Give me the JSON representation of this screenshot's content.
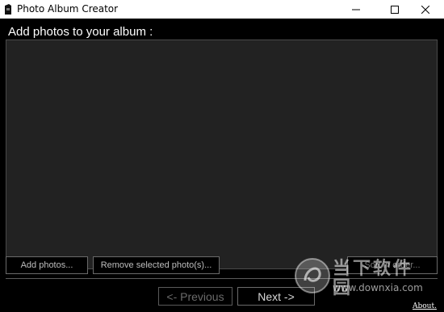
{
  "window": {
    "title": "Photo Album Creator"
  },
  "main": {
    "heading": "Add photos to your album :",
    "photos": []
  },
  "buttons": {
    "add_photos": "Add photos...",
    "remove_selected": "Remove selected photo(s)...",
    "sort": "Sort in order...",
    "previous": "<- Previous",
    "next": "Next ->"
  },
  "about_link": "About.",
  "watermark": {
    "logo_label": "当下软件园",
    "url": "www.downxia.com"
  },
  "colors": {
    "background": "#000000",
    "list_background": "#222222",
    "titlebar": "#ffffff"
  },
  "icons": [
    "app-icon",
    "minimize-icon",
    "maximize-icon",
    "close-icon"
  ]
}
